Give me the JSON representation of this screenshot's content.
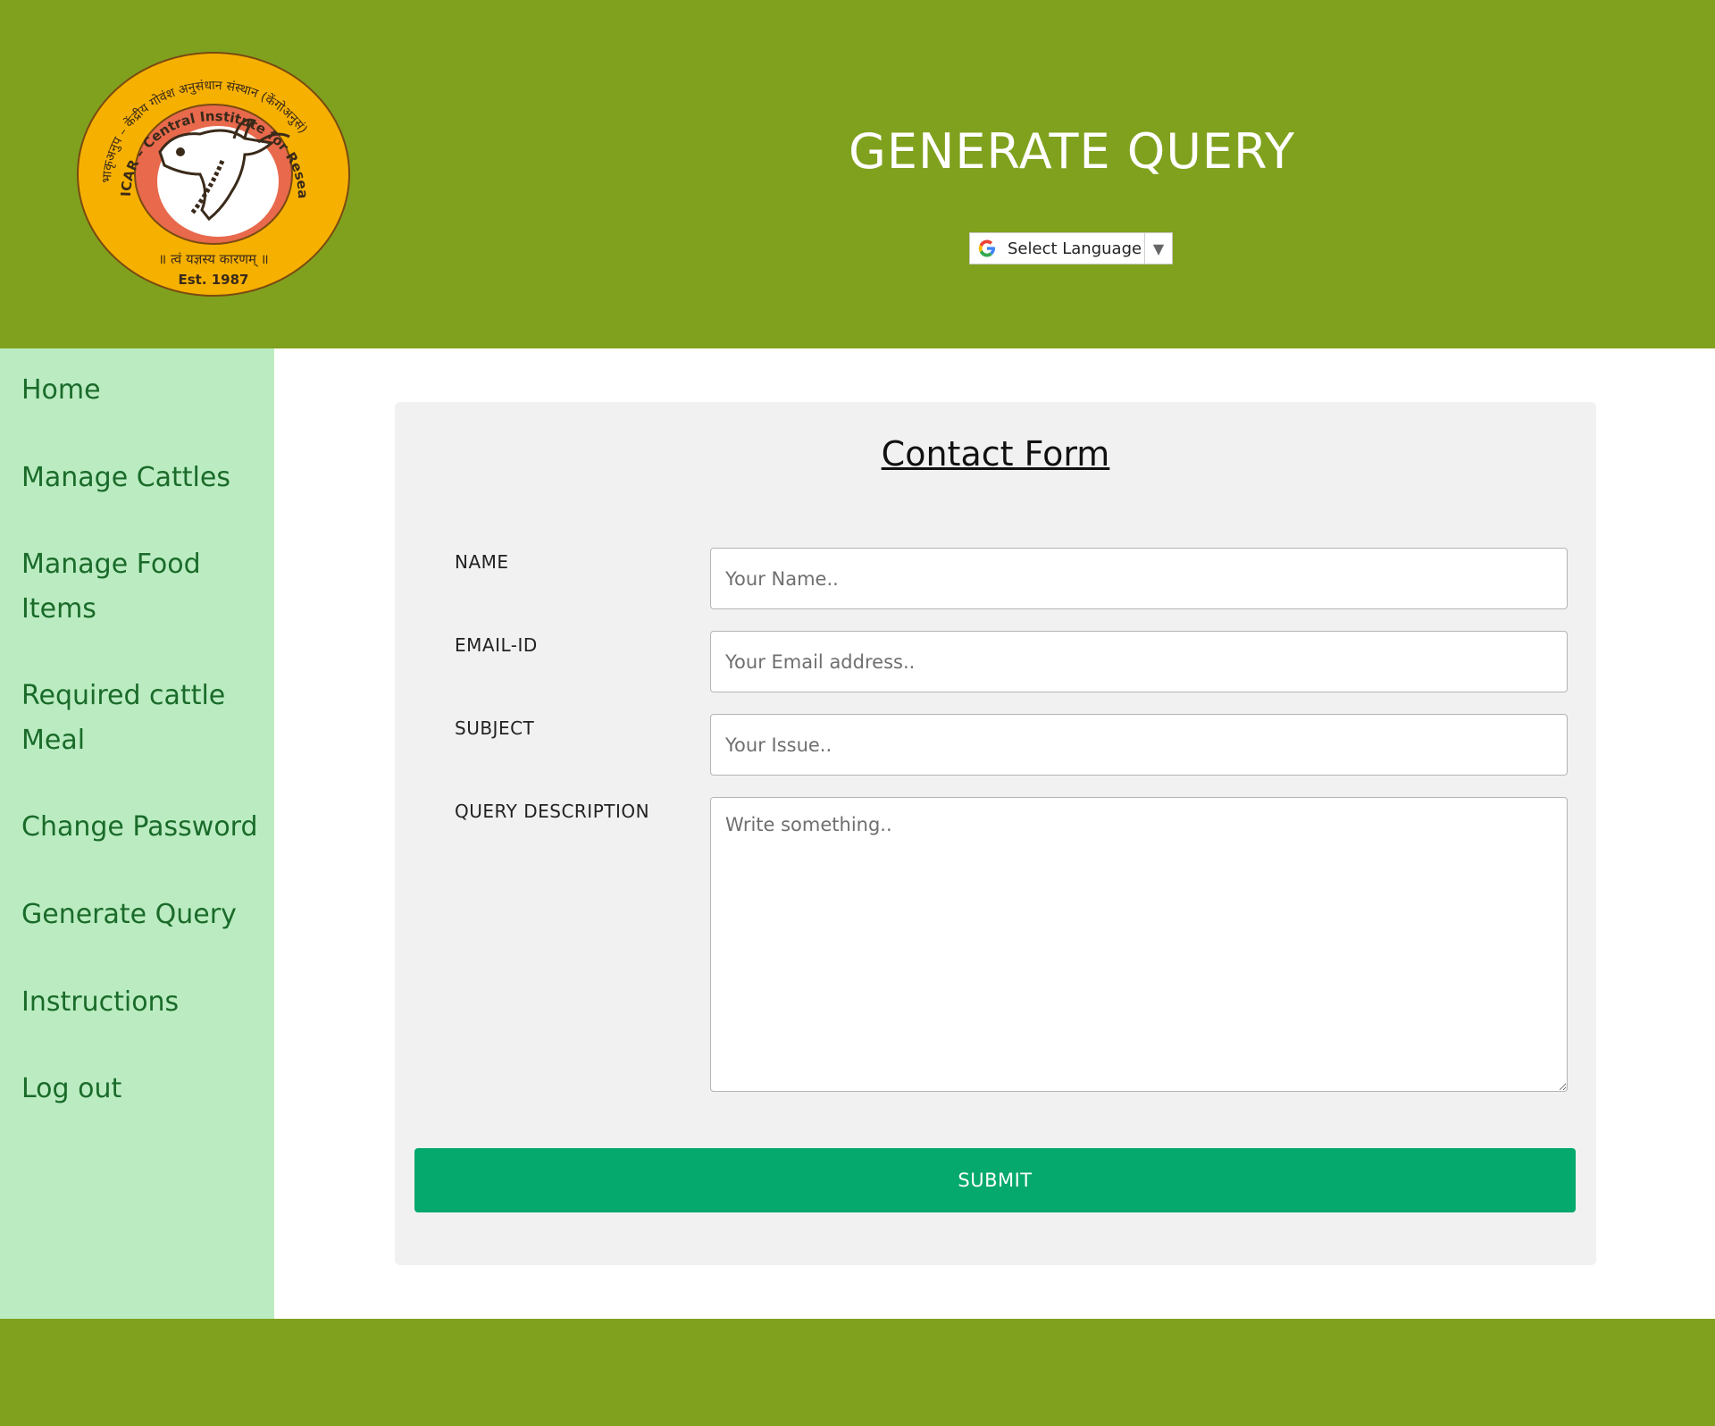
{
  "header": {
    "title": "GENERATE QUERY",
    "logo": {
      "top_arc_text": "भाकृअनुप – केंद्रीय गोवंश अनुसंधान संस्थान (केंगोअनुसं)",
      "inner_arc_text": "ICAR – Central Institute for Research on Cattle (CIRC)",
      "motto": "॥ त्वं यज्ञस्य कारणम् ॥",
      "established": "Est. 1987"
    },
    "language_selector": {
      "label": "Select Language",
      "icon": "google-g-icon"
    }
  },
  "sidebar": {
    "items": [
      {
        "label_lines": [
          "Home"
        ]
      },
      {
        "label_lines": [
          "Manage Cattles"
        ]
      },
      {
        "label_lines": [
          "Manage Food",
          "Items"
        ]
      },
      {
        "label_lines": [
          "Required cattle",
          "Meal"
        ]
      },
      {
        "label_lines": [
          "Change Password"
        ]
      },
      {
        "label_lines": [
          "Generate Query"
        ]
      },
      {
        "label_lines": [
          "Instructions"
        ]
      },
      {
        "label_lines": [
          "Log out"
        ]
      }
    ]
  },
  "form": {
    "title": "Contact Form",
    "fields": [
      {
        "label": "NAME",
        "value": "",
        "placeholder": "Your Name.."
      },
      {
        "label": "EMAIL-ID",
        "value": "",
        "placeholder": "Your Email address.."
      },
      {
        "label": "SUBJECT",
        "value": "",
        "placeholder": "Your Issue.."
      },
      {
        "label": "QUERY DESCRIPTION",
        "value": "",
        "placeholder": "Write something.."
      }
    ],
    "submit_label": "SUBMIT"
  },
  "colors": {
    "header_bg": "#80a11e",
    "sidebar_bg": "#bbecc1",
    "nav_text": "#1a6b2a",
    "card_bg": "#f1f1f1",
    "submit_bg": "#05a96d",
    "logo_ring": "#f6b000",
    "logo_inner": "#e8694c"
  }
}
